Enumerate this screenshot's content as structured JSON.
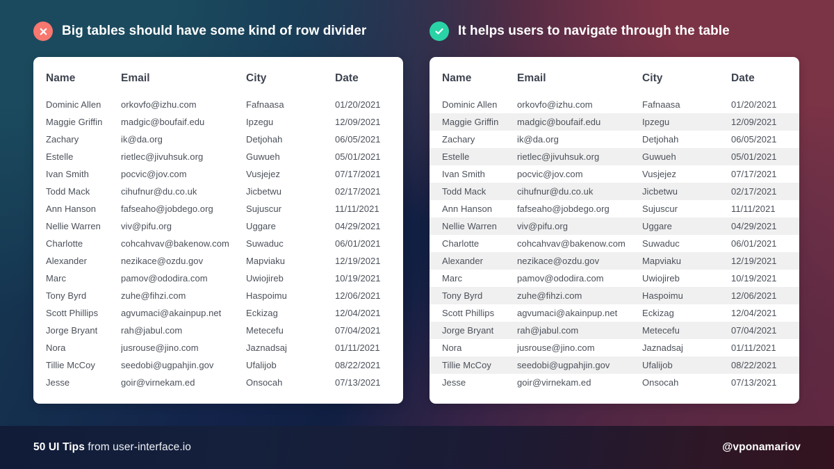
{
  "theme": {
    "bad_color": "#f8776f",
    "good_color": "#2ad3a6",
    "card_bg": "#ffffff",
    "stripe_color": "#f0f0f0",
    "header_text_color": "#3e4450",
    "body_text_color": "#4b5059",
    "title_color": "#ffffff"
  },
  "panels": [
    {
      "id": "bad",
      "icon": "x-circle-icon",
      "title": "Big tables should have some kind of row divider",
      "striped": false
    },
    {
      "id": "good",
      "icon": "check-circle-icon",
      "title": "It helps users to navigate through the table",
      "striped": true
    }
  ],
  "table": {
    "columns": [
      "Name",
      "Email",
      "City",
      "Date"
    ],
    "rows": [
      [
        "Dominic Allen",
        "orkovfo@izhu.com",
        "Fafnaasa",
        "01/20/2021"
      ],
      [
        "Maggie Griffin",
        "madgic@boufaif.edu",
        "Ipzegu",
        "12/09/2021"
      ],
      [
        "Zachary",
        "ik@da.org",
        "Detjohah",
        "06/05/2021"
      ],
      [
        "Estelle",
        "rietlec@jivuhsuk.org",
        "Guwueh",
        "05/01/2021"
      ],
      [
        "Ivan Smith",
        "pocvic@jov.com",
        "Vusjejez",
        "07/17/2021"
      ],
      [
        "Todd Mack",
        "cihufnur@du.co.uk",
        "Jicbetwu",
        "02/17/2021"
      ],
      [
        "Ann Hanson",
        "fafseaho@jobdego.org",
        "Sujuscur",
        "11/11/2021"
      ],
      [
        "Nellie Warren",
        "viv@pifu.org",
        "Uggare",
        "04/29/2021"
      ],
      [
        "Charlotte",
        "cohcahvav@bakenow.com",
        "Suwaduc",
        "06/01/2021"
      ],
      [
        "Alexander",
        "nezikace@ozdu.gov",
        "Mapviaku",
        "12/19/2021"
      ],
      [
        "Marc",
        "pamov@ododira.com",
        "Uwiojireb",
        "10/19/2021"
      ],
      [
        "Tony Byrd",
        "zuhe@fihzi.com",
        "Haspoimu",
        "12/06/2021"
      ],
      [
        "Scott Phillips",
        "agvumaci@akainpup.net",
        "Eckizag",
        "12/04/2021"
      ],
      [
        "Jorge Bryant",
        "rah@jabul.com",
        "Metecefu",
        "07/04/2021"
      ],
      [
        "Nora",
        "jusrouse@jino.com",
        "Jaznadsaj",
        "01/11/2021"
      ],
      [
        "Tillie McCoy",
        "seedobi@ugpahjin.gov",
        "Ufalijob",
        "08/22/2021"
      ],
      [
        "Jesse",
        "goir@virnekam.ed",
        "Onsocah",
        "07/13/2021"
      ]
    ]
  },
  "footer": {
    "brand_bold": "50 UI Tips",
    "brand_rest": " from user-interface.io",
    "handle": "@vponamariov"
  }
}
